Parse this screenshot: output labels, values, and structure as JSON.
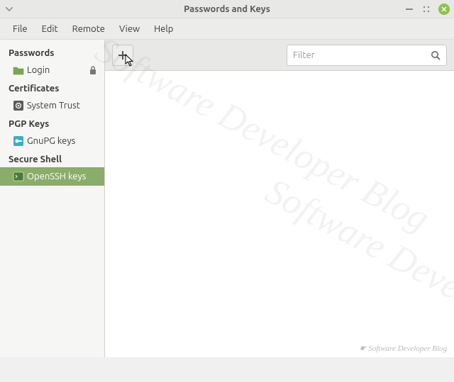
{
  "window": {
    "title": "Passwords and Keys"
  },
  "menubar": {
    "file": "File",
    "edit": "Edit",
    "remote": "Remote",
    "view": "View",
    "help": "Help"
  },
  "sidebar": {
    "headings": {
      "passwords": "Passwords",
      "certificates": "Certificates",
      "pgp": "PGP Keys",
      "ssh": "Secure Shell"
    },
    "items": {
      "login": "Login",
      "system_trust": "System Trust",
      "gnupg": "GnuPG keys",
      "openssh": "OpenSSH keys"
    }
  },
  "toolbar": {
    "add_tooltip": "Add",
    "search_placeholder": "Filter"
  },
  "watermark": "Software Developer Blog",
  "footer": "☛ Software Developer Blog"
}
